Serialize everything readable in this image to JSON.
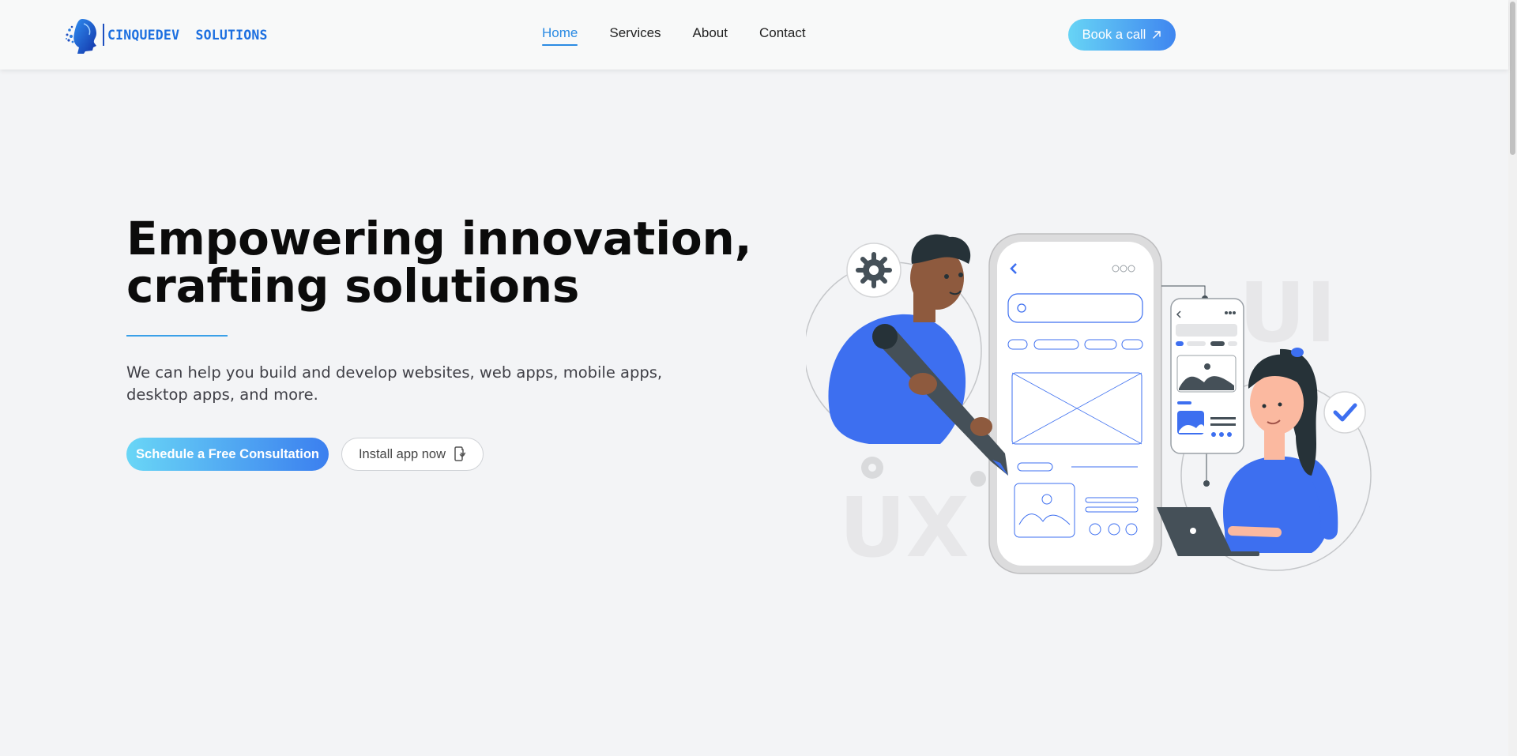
{
  "header": {
    "logo_text": "CINQUEDEV  SOLUTIONS",
    "nav": [
      {
        "label": "Home",
        "active": true
      },
      {
        "label": "Services",
        "active": false
      },
      {
        "label": "About",
        "active": false
      },
      {
        "label": "Contact",
        "active": false
      }
    ],
    "book_button": {
      "label": "Book a call",
      "icon": "arrow-up-right-icon"
    }
  },
  "hero": {
    "title_line1": "Empowering innovation,",
    "title_line2": "crafting solutions",
    "subtitle": "We can help you build and develop websites, web apps, mobile apps, desktop apps, and more.",
    "primary_cta": "Schedule a Free Consultation",
    "secondary_cta": {
      "label": "Install app now",
      "icon": "install-phone-icon"
    }
  },
  "illustration": {
    "watermark_left": "UX",
    "watermark_right": "UI"
  },
  "colors": {
    "accent": "#2b8be3",
    "gradient_start": "#67d4f5",
    "gradient_end": "#3f86f0",
    "figure_blue": "#3d6ff0",
    "dark_slate": "#455058",
    "background": "#f3f4f6"
  }
}
